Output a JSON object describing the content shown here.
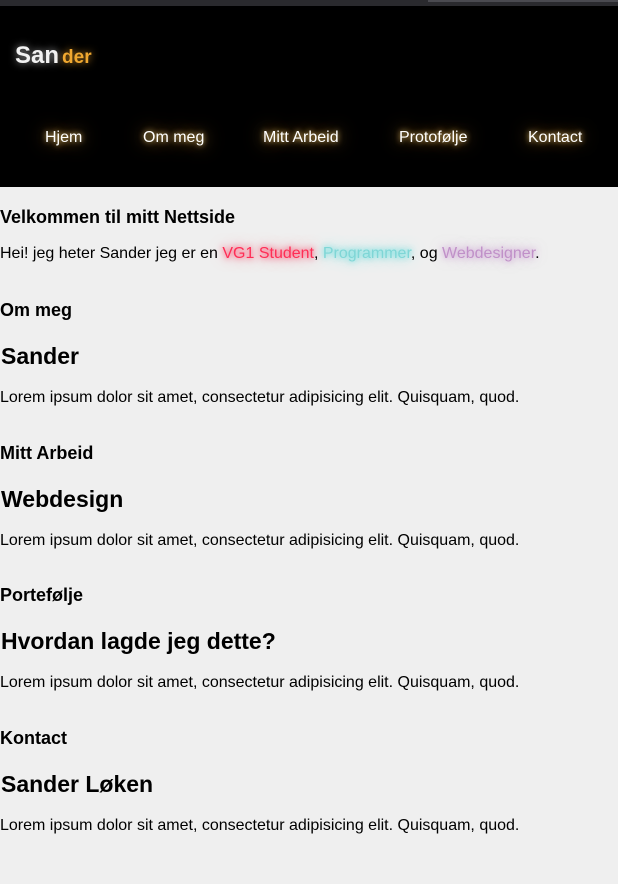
{
  "header": {
    "logo_part1": "San",
    "logo_part2": "der",
    "nav": [
      "Hjem",
      "Om meg",
      "Mitt Arbeid",
      "Protofølje",
      "Kontact"
    ]
  },
  "intro": {
    "title": "Velkommen til mitt Nettside",
    "text_before": "Hei! jeg heter Sander jeg er en ",
    "highlight1": "VG1 Student",
    "sep1": ", ",
    "highlight2": "Programmer",
    "sep2": ", og ",
    "highlight3": "Webdesigner",
    "text_after": "."
  },
  "sections": [
    {
      "label": "Om meg",
      "title": "Sander",
      "text": "Lorem ipsum dolor sit amet, consectetur adipisicing elit. Quisquam, quod."
    },
    {
      "label": "Mitt Arbeid",
      "title": "Webdesign",
      "text": "Lorem ipsum dolor sit amet, consectetur adipisicing elit. Quisquam, quod."
    },
    {
      "label": "Portefølje",
      "title": "Hvordan lagde jeg dette?",
      "text": "Lorem ipsum dolor sit amet, consectetur adipisicing elit. Quisquam, quod."
    },
    {
      "label": "Kontact",
      "title": "Sander Løken",
      "text": "Lorem ipsum dolor sit amet, consectetur adipisicing elit. Quisquam, quod."
    }
  ],
  "colors": {
    "header_bg": "#000000",
    "page_bg": "#efefef",
    "logo_accent": "#f0a830",
    "highlight_red": "#ff2d55",
    "highlight_cyan": "#7fd6d6",
    "highlight_violet": "#c090c8"
  }
}
